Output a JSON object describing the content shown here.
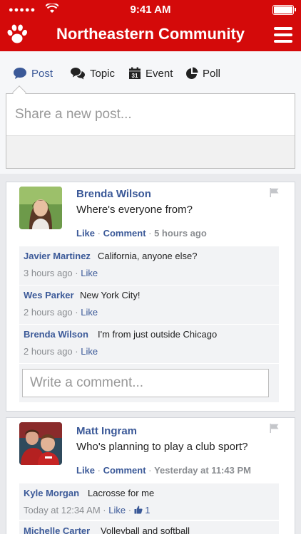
{
  "status": {
    "signal": "●●●●●",
    "time": "9:41 AM"
  },
  "header": {
    "title": "Northeastern Community"
  },
  "composer": {
    "tabs": [
      {
        "label": "Post",
        "icon": "chat-bubble-icon"
      },
      {
        "label": "Topic",
        "icon": "conversation-icon"
      },
      {
        "label": "Event",
        "icon": "calendar-icon",
        "badge": "31"
      },
      {
        "label": "Poll",
        "icon": "pie-chart-icon"
      }
    ],
    "placeholder": "Share a new post..."
  },
  "posts": [
    {
      "author": "Brenda Wilson",
      "text": "Where's everyone from?",
      "like": "Like",
      "comment": "Comment",
      "time": "5 hours ago",
      "comments": [
        {
          "author": "Javier Martinez",
          "text": "California, anyone else?",
          "time": "3 hours ago",
          "like": "Like"
        },
        {
          "author": "Wes Parker",
          "text": "New York City!",
          "time": "2 hours ago",
          "like": "Like"
        },
        {
          "author": "Brenda Wilson",
          "text": "I'm from just outside Chicago",
          "time": "2 hours ago",
          "like": "Like"
        }
      ],
      "write_placeholder": "Write a comment..."
    },
    {
      "author": "Matt Ingram",
      "text": "Who's planning to play a club sport?",
      "like": "Like",
      "comment": "Comment",
      "time": "Yesterday at 11:43 PM",
      "comments": [
        {
          "author": "Kyle Morgan",
          "text": "Lacrosse for me",
          "time": "Today at 12:34 AM",
          "like": "Like",
          "like_count": "1"
        },
        {
          "author": "Michelle Carter",
          "text": "Volleyball and softball"
        }
      ]
    }
  ],
  "colors": {
    "brand": "#d40a0a",
    "link": "#3b5998",
    "muted": "#8a8d91"
  }
}
